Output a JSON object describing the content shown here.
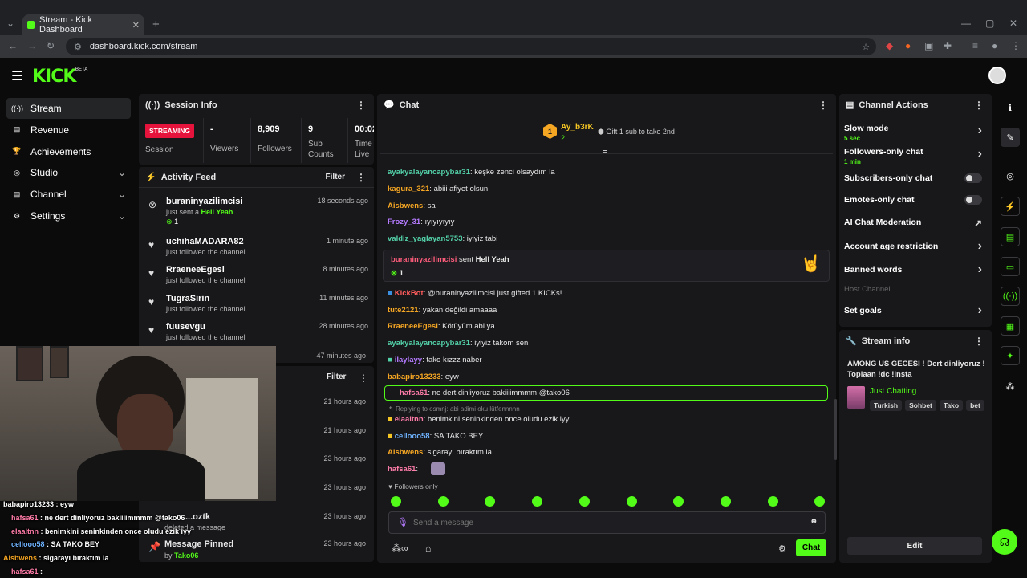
{
  "browser": {
    "tab_title": "Stream - Kick Dashboard",
    "url": "dashboard.kick.com/stream"
  },
  "brand": {
    "logo": "KICK",
    "beta": "BETA",
    "accent": "#53fc18"
  },
  "nav": [
    {
      "label": "Stream",
      "icon": "broadcast-icon",
      "active": true
    },
    {
      "label": "Revenue",
      "icon": "revenue-icon"
    },
    {
      "label": "Achievements",
      "icon": "trophy-icon"
    },
    {
      "label": "Studio",
      "icon": "studio-icon",
      "expandable": true
    },
    {
      "label": "Channel",
      "icon": "channel-icon",
      "expandable": true
    },
    {
      "label": "Settings",
      "icon": "gear-icon",
      "expandable": true
    }
  ],
  "session": {
    "title": "Session Info",
    "status": "STREAMING",
    "status_label": "Session",
    "stats": [
      {
        "value": "-",
        "label": "Viewers"
      },
      {
        "value": "8,909",
        "label": "Followers"
      },
      {
        "value": "9",
        "label": "Sub Counts"
      },
      {
        "value": "00:02",
        "label": "Time Live"
      }
    ]
  },
  "activity": {
    "title": "Activity Feed",
    "filter": "Filter",
    "items": [
      {
        "name": "buraninyazilimcisi",
        "sub": "just sent a",
        "gift": "Hell Yeah",
        "count": "1",
        "time": "18 seconds ago"
      },
      {
        "name": "uchihaMADARA82",
        "sub": "just followed the channel",
        "time": "1 minute ago"
      },
      {
        "name": "RraeneeEgesi",
        "sub": "just followed the channel",
        "time": "8 minutes ago"
      },
      {
        "name": "TugraSirin",
        "sub": "just followed the channel",
        "time": "11 minutes ago"
      },
      {
        "name": "fuusevgu",
        "sub": "just followed the channel",
        "time": "28 minutes ago"
      }
    ],
    "time6": "47 minutes ago"
  },
  "panel2": {
    "filter": "Filter",
    "times": [
      "21 hours ago",
      "21 hours ago",
      "23 hours ago",
      "23 hours ago",
      "23 hours ago"
    ],
    "deleted_user": "...oztk",
    "deleted_sub": "deleted a message",
    "pinned_title": "Message Pinned",
    "pinned_by": "by",
    "pinned_user": "Tako06"
  },
  "overlay": [
    {
      "user": "babapiro13233",
      "msg": " : eyw",
      "color": "#ffffff"
    },
    {
      "user": "hafsa61",
      "msg": " : ne dert dinliyoruz bakiiiimmmm @tako06",
      "color": "#ff7ca8"
    },
    {
      "user": "elaaltnn",
      "msg": " : benimkini seninkinden once oludu ezik iyy",
      "color": "#ff7ca8"
    },
    {
      "user": "cellooo58",
      "msg": " : SA TAKO BEY",
      "color": "#6fb3ff"
    },
    {
      "user": "Aisbwens",
      "msg": " : sigarayı bıraktım la",
      "color": "#f5a623"
    },
    {
      "user": "hafsa61",
      "msg": " :",
      "color": "#ff7ca8"
    }
  ],
  "chat": {
    "title": "Chat",
    "top_gifter": "Ay_b3rK",
    "top_gifter_count": "2",
    "rank": "1",
    "gift_prompt": "Gift 1 sub to take 2nd",
    "messages": [
      {
        "user": "ayakyalayancapybar31",
        "color": "#53d1a8",
        "text": ": keşke zenci olsaydım la"
      },
      {
        "user": "kagura_321",
        "color": "#f5a623",
        "text": ": abiii afiyet olsun"
      },
      {
        "user": "Aisbwens",
        "color": "#f5a623",
        "text": ": sa"
      },
      {
        "user": "Frozy_31",
        "color": "#b57bff",
        "text": ": ıyıyıyıyıy"
      },
      {
        "user": "valdiz_yaglayan5753",
        "color": "#53d1a8",
        "text": ": iyiyiz tabi"
      }
    ],
    "gift_card": {
      "user": "buraninyazilimcisi",
      "verb": "sent",
      "item": "Hell Yeah",
      "count": "1"
    },
    "messages2": [
      {
        "user": "KickBot",
        "color": "#ff5c5c",
        "text": ": @buraninyazilimcisi just gifted 1 KICKs!"
      },
      {
        "user": "tute2121",
        "color": "#f5a623",
        "text": ": yakan değildi amaaaa"
      },
      {
        "user": "RraeneeEgesi",
        "color": "#f5a623",
        "text": ": Kötüyüm abi ya"
      },
      {
        "user": "ayakyalayancapybar31",
        "color": "#53d1a8",
        "text": ": iyiyiz takom sen"
      },
      {
        "user": "ilaylayy",
        "color": "#b57bff",
        "text": ": tako kızzz naber"
      },
      {
        "user": "babapiro13233",
        "color": "#f5a623",
        "text": ": eyw"
      }
    ],
    "highlight": {
      "user": "hafsa61",
      "color": "#ff7ca8",
      "text": ": ne dert dinliyoruz bakiiiimmmm @tako06"
    },
    "reply_hint": "Replying to osmnj: abi adimi oku lütfennnnn",
    "messages3": [
      {
        "user": "elaaltnn",
        "color": "#ff7ca8",
        "text": ": benimkini seninkinden once oludu ezik iyy"
      },
      {
        "user": "cellooo58",
        "color": "#6fb3ff",
        "text": ": SA TAKO BEY"
      },
      {
        "user": "Aisbwens",
        "color": "#f5a623",
        "text": ": sigarayı bıraktım la"
      },
      {
        "user": "hafsa61",
        "color": "#ff7ca8",
        "text": ":"
      }
    ],
    "mode": "Followers only",
    "placeholder": "Send a message",
    "send": "Chat"
  },
  "actions": {
    "title": "Channel Actions",
    "items": [
      {
        "label": "Slow mode",
        "sub": "5 sec",
        "type": "arrow"
      },
      {
        "label": "Followers-only chat",
        "sub": "1 min",
        "type": "arrow"
      },
      {
        "label": "Subscribers-only chat",
        "type": "toggle"
      },
      {
        "label": "Emotes-only chat",
        "type": "toggle"
      },
      {
        "label": "AI Chat Moderation",
        "type": "ext"
      },
      {
        "label": "Account age restriction",
        "type": "arrow"
      },
      {
        "label": "Banned words",
        "type": "arrow"
      },
      {
        "label": "Host Channel",
        "type": "disabled"
      },
      {
        "label": "Set goals",
        "type": "arrow"
      }
    ]
  },
  "stream_info": {
    "title": "Stream info",
    "stream_title": "AMONG US GECESI ! Dert dinliyoruz ! Toplaan !dc !insta",
    "category": "Just Chatting",
    "tags": [
      "Turkish",
      "Sohbet",
      "Tako",
      "bet"
    ],
    "edit": "Edit"
  }
}
